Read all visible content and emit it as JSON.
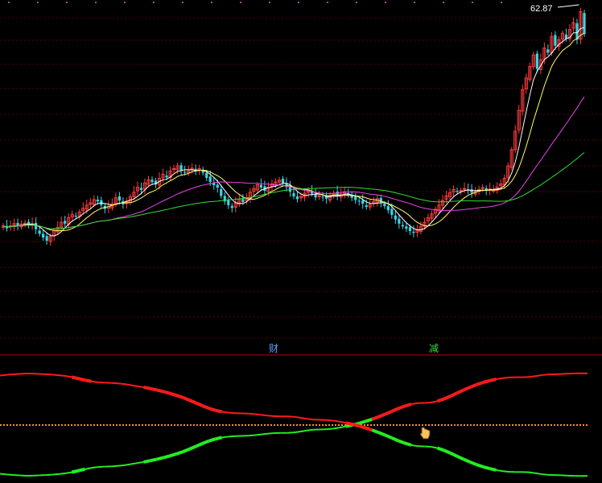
{
  "chart_data": {
    "type": "candlestick",
    "upper": {
      "price_label": "62.87",
      "marker_cai": "财",
      "marker_jian": "减",
      "colors": {
        "up": "#ff3b3b",
        "down": "#38d6e6",
        "ma_fast": "#ffffff",
        "ma_mid": "#ffff66",
        "ma_slow": "#e645e6",
        "ma_long": "#33dd33",
        "grid": "#5a0000"
      },
      "closes": [
        16.5,
        16.0,
        16.5,
        17.0,
        16.6,
        16.9,
        17.1,
        16.8,
        17.0,
        15.8,
        14.8,
        14.0,
        13.3,
        14.2,
        15.5,
        16.2,
        17.3,
        17.0,
        18.3,
        19.0,
        18.6,
        19.5,
        20.3,
        21.0,
        21.5,
        22.2,
        21.8,
        21.0,
        20.2,
        20.7,
        21.3,
        22.6,
        22.0,
        21.2,
        21.9,
        22.8,
        23.8,
        24.9,
        24.3,
        25.8,
        26.5,
        26.0,
        25.5,
        26.8,
        27.7,
        27.0,
        28.4,
        28.9,
        29.5,
        28.5,
        28.0,
        28.4,
        29.0,
        28.5,
        28.9,
        28.0,
        26.9,
        26.0,
        25.3,
        24.8,
        23.0,
        21.8,
        21.0,
        20.4,
        21.5,
        22.3,
        21.7,
        22.6,
        23.8,
        24.6,
        25.4,
        24.8,
        24.1,
        24.9,
        25.6,
        26.0,
        26.4,
        25.8,
        24.9,
        23.9,
        22.9,
        22.3,
        22.9,
        23.6,
        24.3,
        23.5,
        22.7,
        23.0,
        22.8,
        22.4,
        23.1,
        23.6,
        22.9,
        23.4,
        23.9,
        23.2,
        22.6,
        22.1,
        21.9,
        21.3,
        20.6,
        21.1,
        21.8,
        22.4,
        21.6,
        20.8,
        19.9,
        18.9,
        17.9,
        17.0,
        16.4,
        15.9,
        15.4,
        15.0,
        15.6,
        16.4,
        17.3,
        18.3,
        19.1,
        20.1,
        21.0,
        22.0,
        23.0,
        23.7,
        24.4,
        23.9,
        24.2,
        24.6,
        24.3,
        23.7,
        24.0,
        24.4,
        24.8,
        24.1,
        24.5,
        24.2,
        24.9,
        25.6,
        26.8,
        29.5,
        33.0,
        37.0,
        41.5,
        46.0,
        48.5,
        51.0,
        53.5,
        50.5,
        52.5,
        55.0,
        54.0,
        57.5,
        55.5,
        56.8,
        58.2,
        57.0,
        59.0,
        60.5,
        56.8,
        62.87,
        58.0
      ]
    },
    "lower": {
      "rising": [
        4.8,
        4.2,
        3.7,
        3.3,
        3.0,
        3.1,
        3.3,
        3.6,
        4.0,
        4.5,
        5.2,
        6.2,
        7.6,
        9.0,
        10.2,
        11.0,
        11.4,
        11.6,
        12.0,
        12.6,
        13.6,
        14.6,
        15.6,
        16.8,
        18.1,
        19.6,
        21.2,
        23.0,
        25.0,
        27.4,
        30.0,
        32.6,
        35.0,
        36.8,
        38.2,
        39.0,
        39.4,
        39.6,
        39.8,
        40.3,
        41.0,
        41.7,
        42.2,
        42.4,
        42.4,
        42.8,
        43.6,
        44.6,
        45.4,
        45.6,
        45.7,
        46.3,
        47.2,
        48.4,
        49.7,
        51.2,
        53.0,
        55.0,
        57.2,
        59.6,
        62.2,
        64.8,
        67.0,
        68.8,
        69.8,
        70.0,
        70.4,
        71.6,
        73.6,
        76.2,
        79.0,
        81.8,
        84.4,
        86.8,
        88.8,
        90.4,
        91.8,
        92.8,
        93.4,
        93.6,
        93.6,
        93.8,
        94.6,
        95.6,
        96.2,
        96.4,
        96.6,
        96.9,
        97.1,
        97.2,
        97.2
      ]
    }
  }
}
